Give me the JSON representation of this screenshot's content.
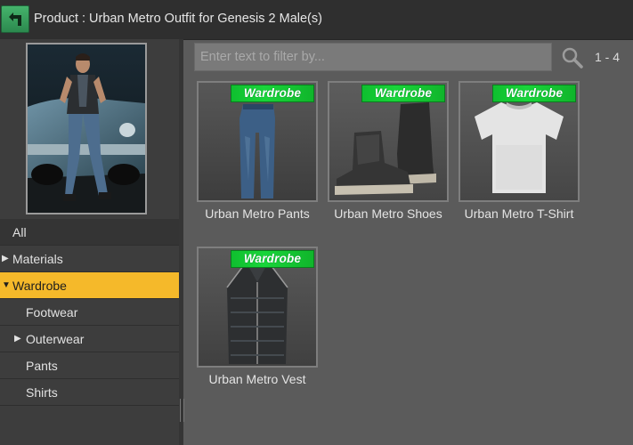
{
  "header": {
    "title": "Product : Urban Metro Outfit for Genesis 2 Male(s)",
    "back_icon": "back-arrow-icon"
  },
  "filter": {
    "placeholder": "Enter text to filter by...",
    "value": "",
    "range": "1 - 4"
  },
  "categories": [
    {
      "label": "All",
      "expanded": null,
      "selected": false
    },
    {
      "label": "Materials",
      "expanded": false,
      "selected": false
    },
    {
      "label": "Wardrobe",
      "expanded": true,
      "selected": true
    },
    {
      "label": "Footwear",
      "expanded": null,
      "selected": false
    },
    {
      "label": "Outerwear",
      "expanded": false,
      "selected": false
    },
    {
      "label": "Pants",
      "expanded": null,
      "selected": false
    },
    {
      "label": "Shirts",
      "expanded": null,
      "selected": false
    }
  ],
  "items": [
    {
      "name": "Urban Metro Pants",
      "badge": "Wardrobe"
    },
    {
      "name": "Urban Metro Shoes",
      "badge": "Wardrobe"
    },
    {
      "name": "Urban Metro T-Shirt",
      "badge": "Wardrobe"
    },
    {
      "name": "Urban Metro Vest",
      "badge": "Wardrobe"
    }
  ],
  "colors": {
    "accent_selected": "#f5b92a",
    "badge_green": "#19d53a",
    "back_button": "#2c8a4f"
  }
}
